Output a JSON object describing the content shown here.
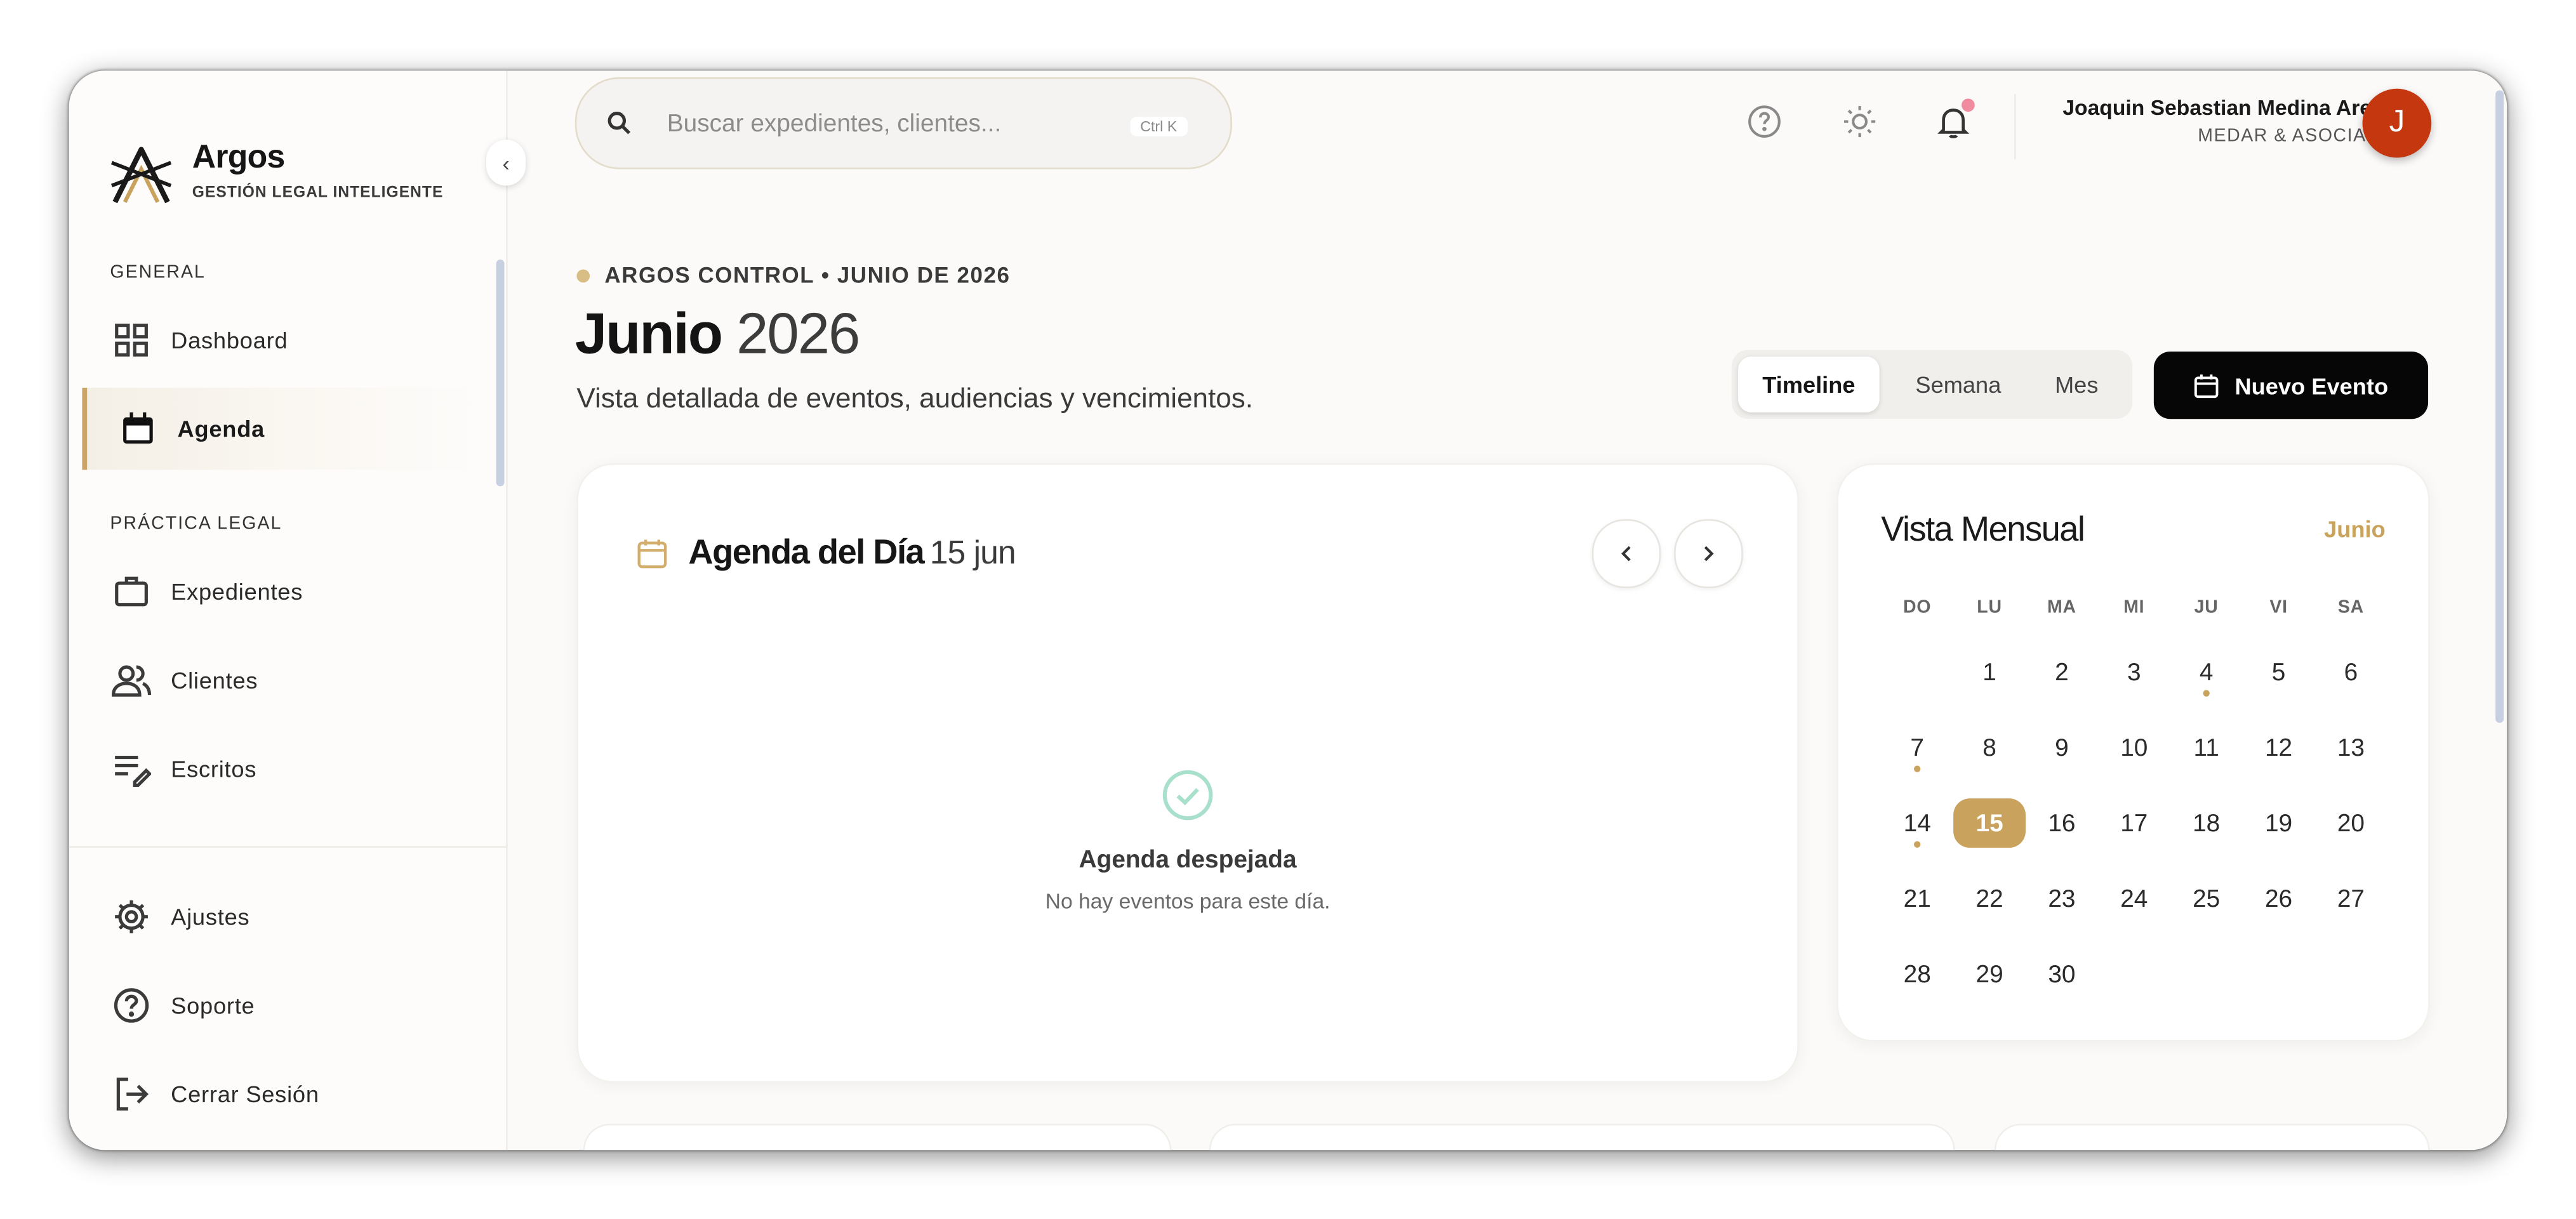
{
  "brand": {
    "name": "Argos",
    "tagline": "GESTIÓN LEGAL INTELIGENTE"
  },
  "sidebar": {
    "section_general": "GENERAL",
    "section_legal": "PRÁCTICA LEGAL",
    "items": [
      {
        "label": "Dashboard",
        "icon": "grid-icon"
      },
      {
        "label": "Agenda",
        "icon": "calendar-icon",
        "active": true
      },
      {
        "label": "Expedientes",
        "icon": "briefcase-icon"
      },
      {
        "label": "Clientes",
        "icon": "users-icon"
      },
      {
        "label": "Escritos",
        "icon": "edit-note-icon"
      }
    ],
    "bottom_items": [
      {
        "label": "Ajustes",
        "icon": "gear-icon"
      },
      {
        "label": "Soporte",
        "icon": "help-circle-icon"
      },
      {
        "label": "Cerrar Sesión",
        "icon": "logout-icon"
      }
    ]
  },
  "header": {
    "search_placeholder": "Buscar expedientes, clientes...",
    "search_shortcut": "Ctrl K",
    "user_name": "Joaquin Sebastian Medina Arenas",
    "user_firm": "MEDAR & ASOCIADOS",
    "avatar_initial": "J",
    "notification_badge_color": "#f08ba0"
  },
  "page": {
    "eyebrow": "ARGOS CONTROL • JUNIO DE 2026",
    "title_month": "Junio",
    "title_year": "2026",
    "description": "Vista detallada de eventos, audiencias y vencimientos.",
    "view_tabs": [
      {
        "label": "Timeline",
        "active": true
      },
      {
        "label": "Semana"
      },
      {
        "label": "Mes"
      }
    ],
    "new_event_label": "Nuevo Evento"
  },
  "day_agenda": {
    "title": "Agenda del Día",
    "date": "15 jun",
    "empty_title": "Agenda despejada",
    "empty_subtitle": "No hay eventos para este día."
  },
  "month_view": {
    "title": "Vista Mensual",
    "month_label": "Junio",
    "weekdays": [
      "DO",
      "LU",
      "MA",
      "MI",
      "JU",
      "VI",
      "SA"
    ],
    "start_offset": 1,
    "days_in_month": 30,
    "selected_day": 15,
    "event_days": [
      4,
      7,
      14
    ]
  },
  "colors": {
    "accent": "#c9a35d",
    "avatar_bg": "#c5380f",
    "primary_button": "#060606"
  }
}
